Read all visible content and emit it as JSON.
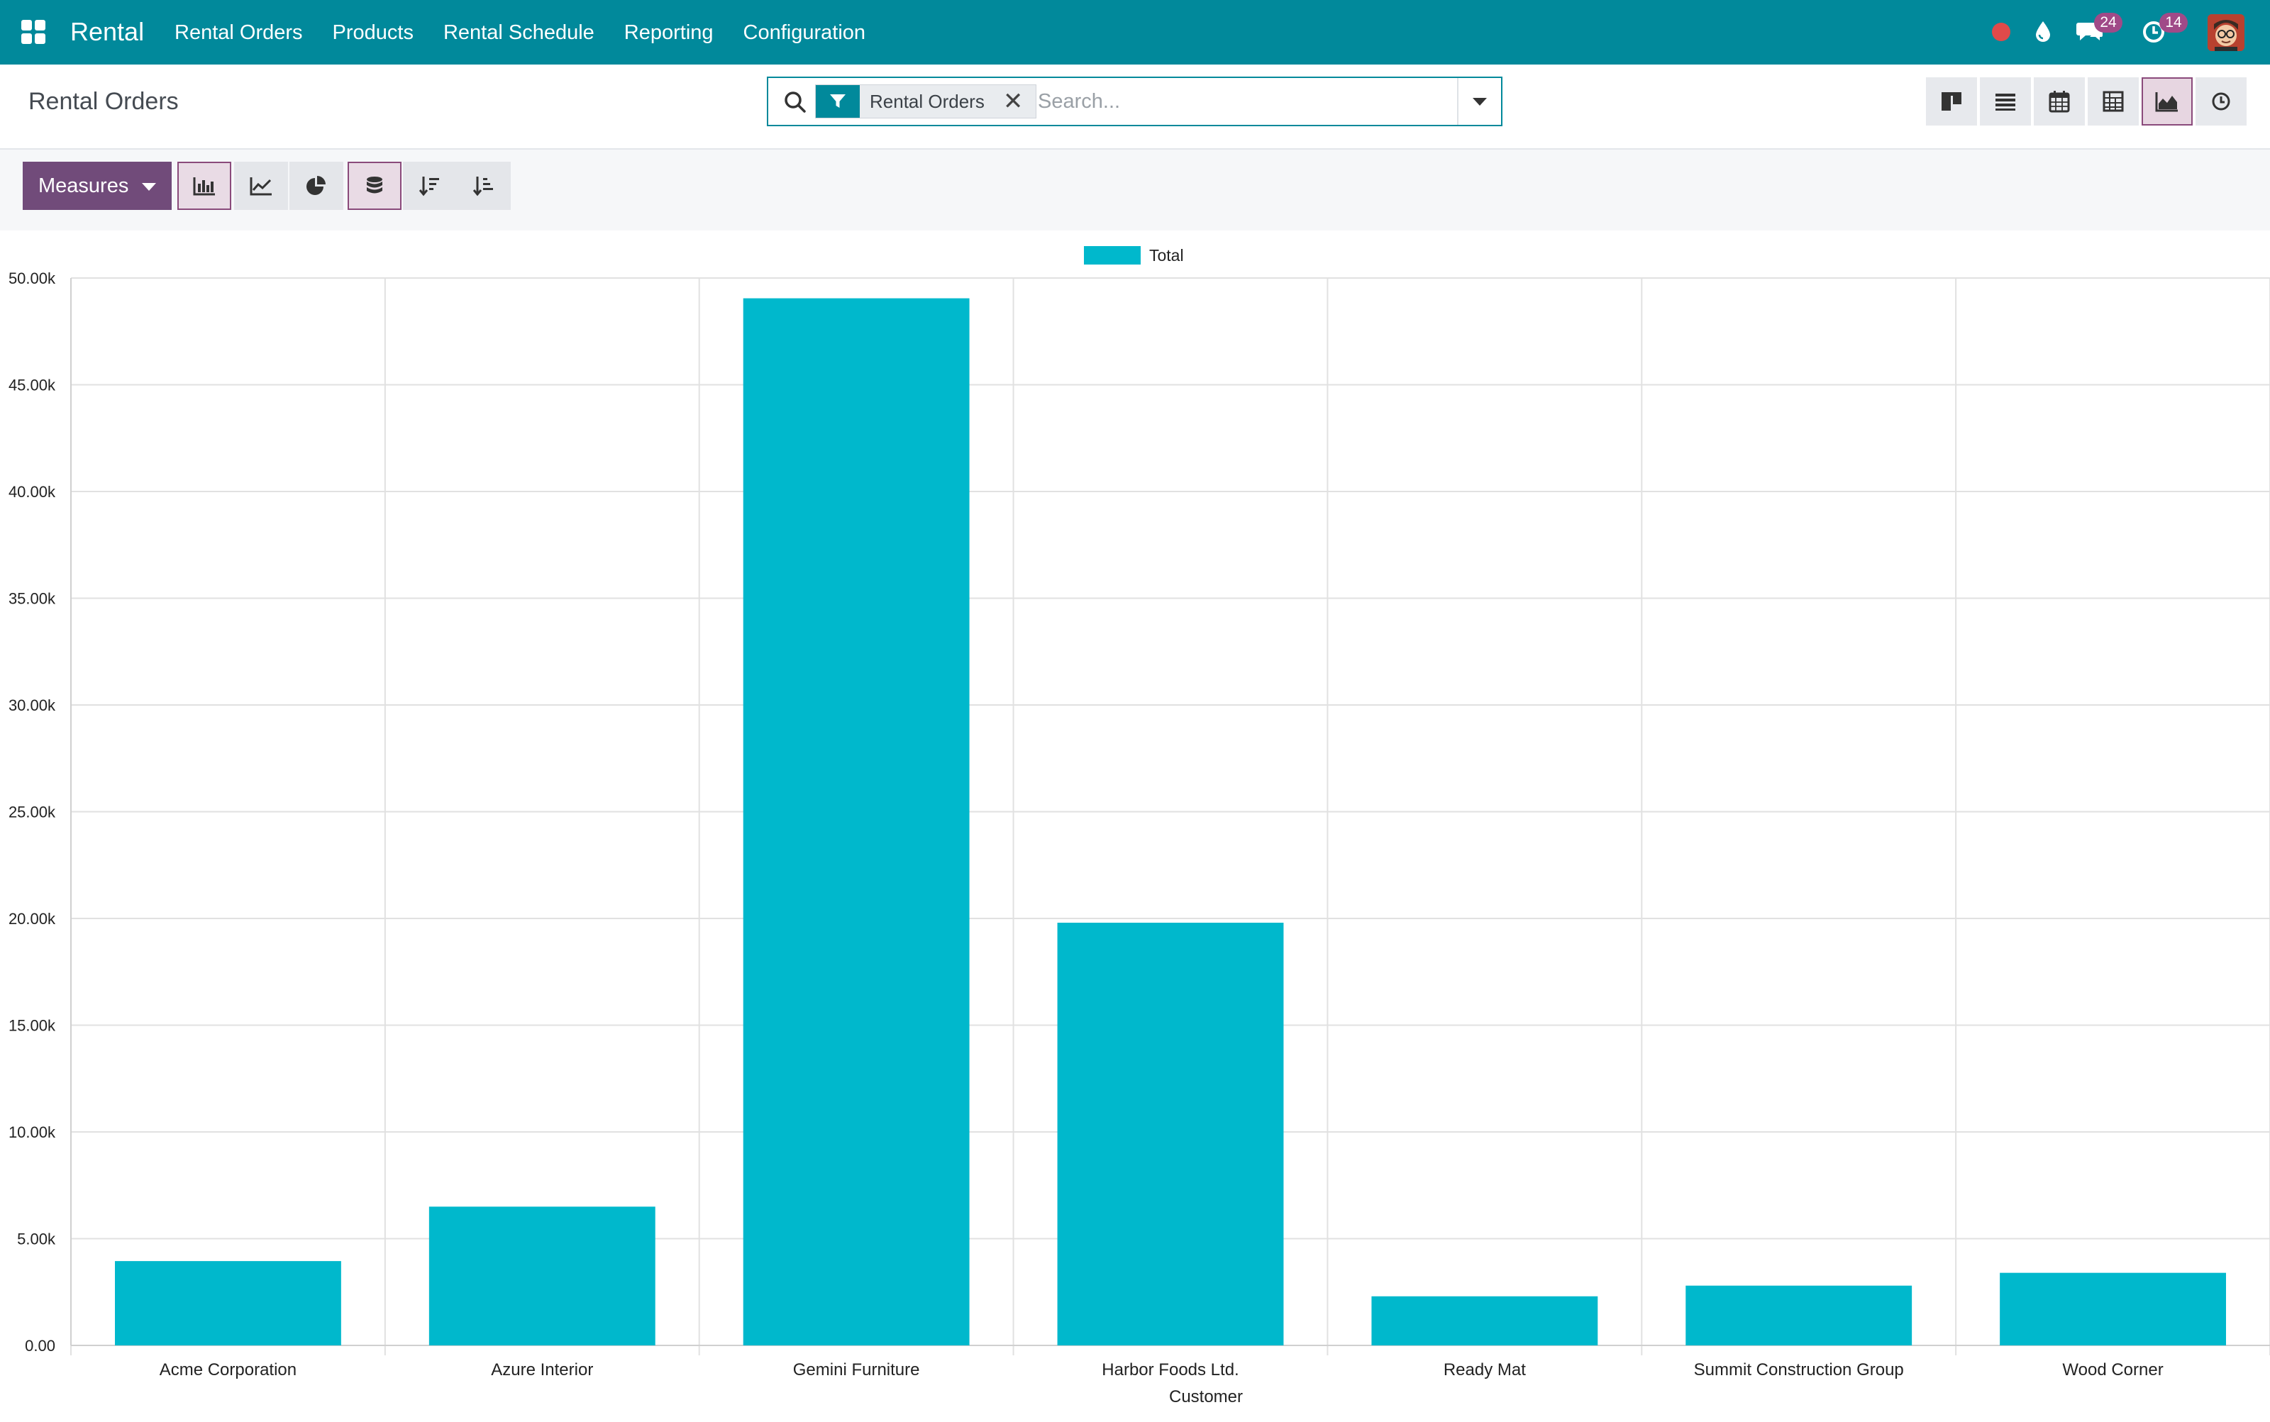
{
  "nav": {
    "brand": "Rental",
    "menu": [
      "Rental Orders",
      "Products",
      "Rental Schedule",
      "Reporting",
      "Configuration"
    ],
    "messages_count": "24",
    "activities_count": "14",
    "icons": [
      "apps-icon",
      "record-dot-icon",
      "droplet-icon",
      "chat-icon",
      "clock-icon",
      "user-avatar"
    ]
  },
  "control_panel": {
    "title": "Rental Orders",
    "search": {
      "facet_label": "Rental Orders",
      "facet_icon": "filter-icon",
      "placeholder": "Search..."
    },
    "views": [
      "kanban-view",
      "list-view",
      "calendar-view",
      "pivot-view",
      "graph-view",
      "activity-view"
    ],
    "active_view": "graph-view"
  },
  "toolbar": {
    "measures_label": "Measures",
    "buttons": [
      "bar-chart-button",
      "line-chart-button",
      "pie-chart-button",
      "stacked-button",
      "sort-descending-button",
      "sort-ascending-button"
    ],
    "active": [
      "bar-chart-button",
      "stacked-button"
    ]
  },
  "colors": {
    "brand": "#01899b",
    "accent": "#714b7a",
    "bar": "#00b8cc"
  },
  "chart_data": {
    "type": "bar",
    "title": "",
    "xlabel": "Customer",
    "ylabel": "",
    "categories": [
      "Acme Corporation",
      "Azure Interior",
      "Gemini Furniture",
      "Harbor Foods Ltd.",
      "Ready Mat",
      "Summit Construction Group",
      "Wood Corner"
    ],
    "series": [
      {
        "name": "Total",
        "values": [
          3950,
          6500,
          49050,
          19800,
          2300,
          2800,
          3400
        ]
      }
    ],
    "ylim": [
      0,
      50000
    ],
    "yticks": [
      "0.00",
      "5.00k",
      "10.00k",
      "15.00k",
      "20.00k",
      "25.00k",
      "30.00k",
      "35.00k",
      "40.00k",
      "45.00k",
      "50.00k"
    ],
    "grid": true,
    "legend": "top-center"
  }
}
